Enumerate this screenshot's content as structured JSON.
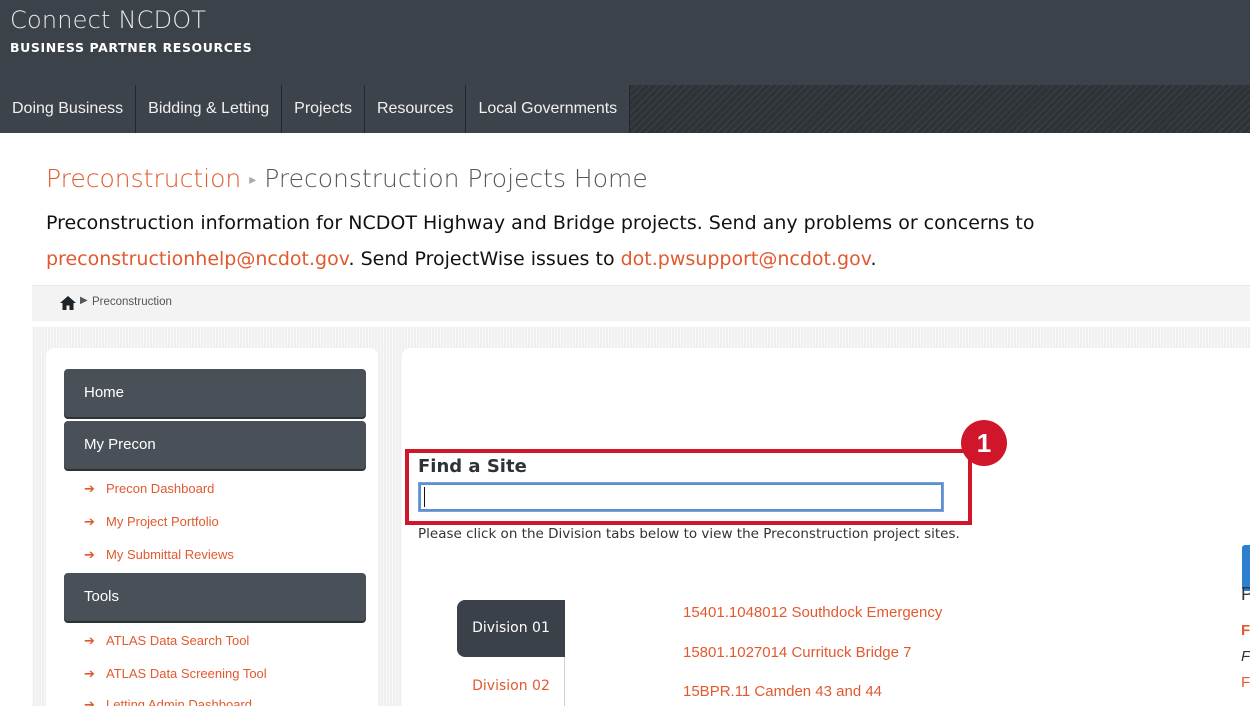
{
  "header": {
    "title": "Connect NCDOT",
    "subtitle": "BUSINESS PARTNER RESOURCES"
  },
  "nav": {
    "items": [
      "Doing Business",
      "Bidding & Letting",
      "Projects",
      "Resources",
      "Local Governments"
    ]
  },
  "page": {
    "crumb_parent": "Preconstruction",
    "crumb_separator": "▸",
    "title": "Preconstruction Projects Home",
    "intro_line1": "Preconstruction information for NCDOT Highway and Bridge projects.  Send any problems or concerns to",
    "intro_email1": "preconstructionhelp@ncdot.gov",
    "intro_mid": ". Send ProjectWise issues to ",
    "intro_email2": "dot.pwsupport@ncdot.gov",
    "intro_end": "."
  },
  "breadcrumb": {
    "arrow": "▶",
    "current": "Preconstruction"
  },
  "sidebar": {
    "home": "Home",
    "my_precon": "My Precon",
    "my_precon_links": [
      "Precon Dashboard",
      "My Project Portfolio",
      "My Submittal Reviews"
    ],
    "tools": "Tools",
    "tools_links": [
      "ATLAS Data Search Tool",
      "ATLAS Data Screening Tool",
      "Letting Admin Dashboard"
    ]
  },
  "find_site": {
    "title": "Find a Site",
    "placeholder": "",
    "annotation_number": "1",
    "hint": "Please click on the Division tabs below to view the Preconstruction project sites."
  },
  "divisions": {
    "tabs": [
      "Division 01",
      "Division 02"
    ]
  },
  "projects": [
    "15401.1048012 Southdock Emergency",
    "15801.1027014 Currituck Bridge 7",
    "15BPR.11 Camden 43 and 44"
  ],
  "right_cutoff": {
    "chars": [
      "P",
      "F",
      "F",
      "F"
    ]
  },
  "colors": {
    "header_bg": "#3c4249",
    "accent_orange": "#e2592f",
    "sidebar_button": "#4a5058",
    "highlight_red": "#d0162b"
  }
}
